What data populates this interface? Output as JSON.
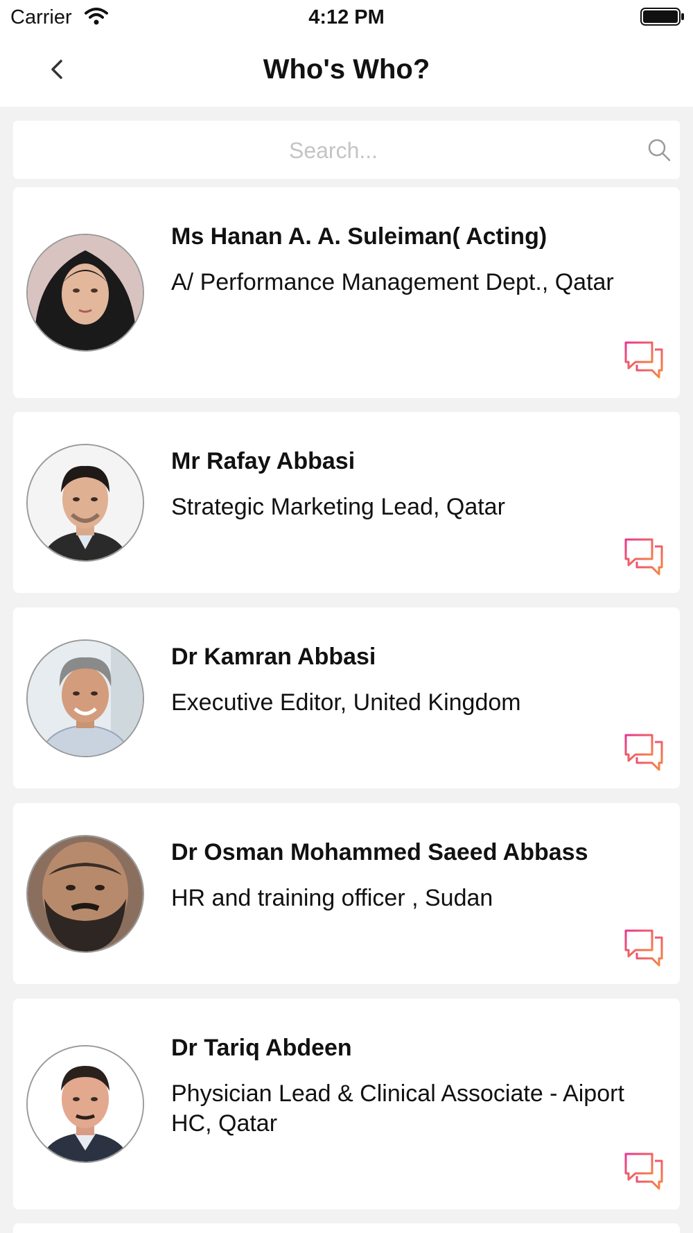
{
  "status_bar": {
    "carrier": "Carrier",
    "time": "4:12 PM"
  },
  "nav": {
    "title": "Who's Who?",
    "back_icon": "chevron-left-icon"
  },
  "search": {
    "placeholder": "Search...",
    "value": "",
    "icon": "search-icon"
  },
  "people": [
    {
      "name": "Ms Hanan A.  A. Suleiman( Acting)",
      "title": "A/ Performance Management Dept., Qatar"
    },
    {
      "name": "Mr Rafay Abbasi",
      "title": "Strategic Marketing Lead, Qatar"
    },
    {
      "name": "Dr Kamran Abbasi",
      "title": "Executive Editor, United Kingdom"
    },
    {
      "name": "Dr Osman Mohammed Saeed Abbass",
      "title": "HR and training officer , Sudan"
    },
    {
      "name": "Dr Tariq Abdeen",
      "title": "Physician Lead & Clinical Associate - Aiport HC, Qatar"
    }
  ],
  "colors": {
    "accent_pink": "#e8368f",
    "accent_orange": "#f68b3c",
    "background": "#f2f2f2"
  },
  "icons": {
    "chat": "chat-bubbles-icon"
  }
}
